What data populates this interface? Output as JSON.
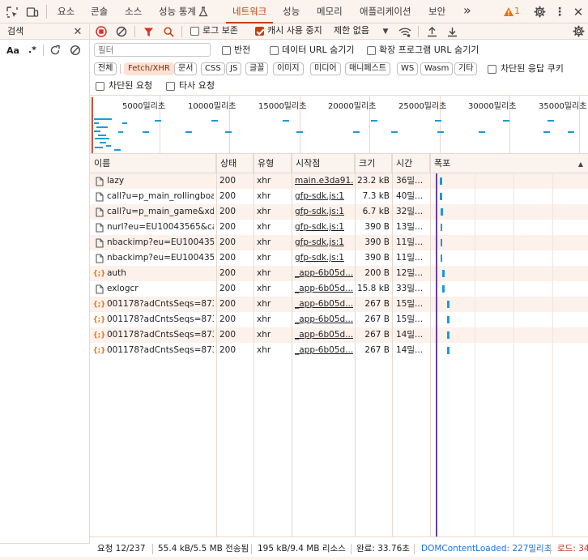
{
  "toolbar": {
    "tabs": [
      "요소",
      "콘솔",
      "소스",
      "성능 통계",
      "네트워크",
      "성능",
      "메모리",
      "애플리케이션",
      "보안"
    ],
    "more": "»",
    "warning_count": "1"
  },
  "search_panel": {
    "title": "검색",
    "case_label": "Aa",
    "regex_label": ".*"
  },
  "network_toolbar": {
    "preserve_log_label": "로그 보존",
    "disable_cache_label": "캐시 사용 중지",
    "throttle_label": "제한 없음"
  },
  "filter_bar": {
    "filter_placeholder": "필터",
    "invert_label": "반전",
    "hide_data_urls_label": "데이터 URL 숨기기",
    "hide_ext_urls_label": "확장 프로그램 URL 숨기기"
  },
  "type_chips": [
    "전체",
    "Fetch/XHR",
    "문서",
    "CSS",
    "JS",
    "글꼴",
    "이미지",
    "미디어",
    "매니페스트",
    "WS",
    "Wasm",
    "기타"
  ],
  "blocked_cookies_label": "차단된 응답 쿠키",
  "blocked_requests_label": "차단된 요청",
  "third_party_label": "타사 요청",
  "timeline_ticks": [
    "5000밀리초",
    "10000밀리초",
    "15000밀리초",
    "20000밀리초",
    "25000밀리초",
    "30000밀리초",
    "35000밀리초"
  ],
  "table": {
    "headers": [
      "이름",
      "상태",
      "유형",
      "시작점",
      "크기",
      "시간",
      "폭포"
    ],
    "rows": [
      {
        "name": "lazy",
        "status": "200",
        "type": "xhr",
        "initiator": "main.e3da91...",
        "size": "23.2 kB",
        "time": "36밀...",
        "kind": "doc"
      },
      {
        "name": "call?u=p_main_rollingboa...",
        "status": "200",
        "type": "xhr",
        "initiator": "gfp-sdk.js:1",
        "size": "7.3 kB",
        "time": "40밀...",
        "kind": "doc"
      },
      {
        "name": "call?u=p_main_game&xdi...",
        "status": "200",
        "type": "xhr",
        "initiator": "gfp-sdk.js:1",
        "size": "6.7 kB",
        "time": "32밀...",
        "kind": "doc"
      },
      {
        "name": "nurl?eu=EU10043565&ca...",
        "status": "200",
        "type": "xhr",
        "initiator": "gfp-sdk.js:1",
        "size": "390 B",
        "time": "13밀...",
        "kind": "doc"
      },
      {
        "name": "nbackimp?eu=EU100435...",
        "status": "200",
        "type": "xhr",
        "initiator": "gfp-sdk.js:1",
        "size": "390 B",
        "time": "11밀...",
        "kind": "doc"
      },
      {
        "name": "nbackimp?eu=EU100435...",
        "status": "200",
        "type": "xhr",
        "initiator": "gfp-sdk.js:1",
        "size": "390 B",
        "time": "11밀...",
        "kind": "doc"
      },
      {
        "name": "auth",
        "status": "200",
        "type": "xhr",
        "initiator": "_app-6b05d...",
        "size": "200 B",
        "time": "12밀...",
        "kind": "json"
      },
      {
        "name": "exlogcr",
        "status": "200",
        "type": "xhr",
        "initiator": "_app-6b05d...",
        "size": "15.8 kB",
        "time": "33밀...",
        "kind": "doc"
      },
      {
        "name": "001178?adCntsSeqs=873...",
        "status": "200",
        "type": "xhr",
        "initiator": "_app-6b05d...",
        "size": "267 B",
        "time": "15밀...",
        "kind": "json"
      },
      {
        "name": "001178?adCntsSeqs=873...",
        "status": "200",
        "type": "xhr",
        "initiator": "_app-6b05d...",
        "size": "267 B",
        "time": "15밀...",
        "kind": "json"
      },
      {
        "name": "001178?adCntsSeqs=873...",
        "status": "200",
        "type": "xhr",
        "initiator": "_app-6b05d...",
        "size": "267 B",
        "time": "14밀...",
        "kind": "json"
      },
      {
        "name": "001178?adCntsSeqs=873...",
        "status": "200",
        "type": "xhr",
        "initiator": "_app-6b05d...",
        "size": "267 B",
        "time": "14밀...",
        "kind": "json"
      }
    ]
  },
  "status_bar": {
    "requests": "요청 12/237",
    "transferred": "55.4 kB/5.5 MB 전송됨",
    "resources": "195 kB/9.4 MB 리소스",
    "finish": "완료: 33.76초",
    "dcl": "DOMContentLoaded: 227밀리초",
    "load": "로드: 34"
  },
  "colors": {
    "accent": "#c2410c",
    "waterfall_bar": "#1a9bd7",
    "dcl_line": "#1a73e8",
    "load_line": "#c0392b"
  }
}
